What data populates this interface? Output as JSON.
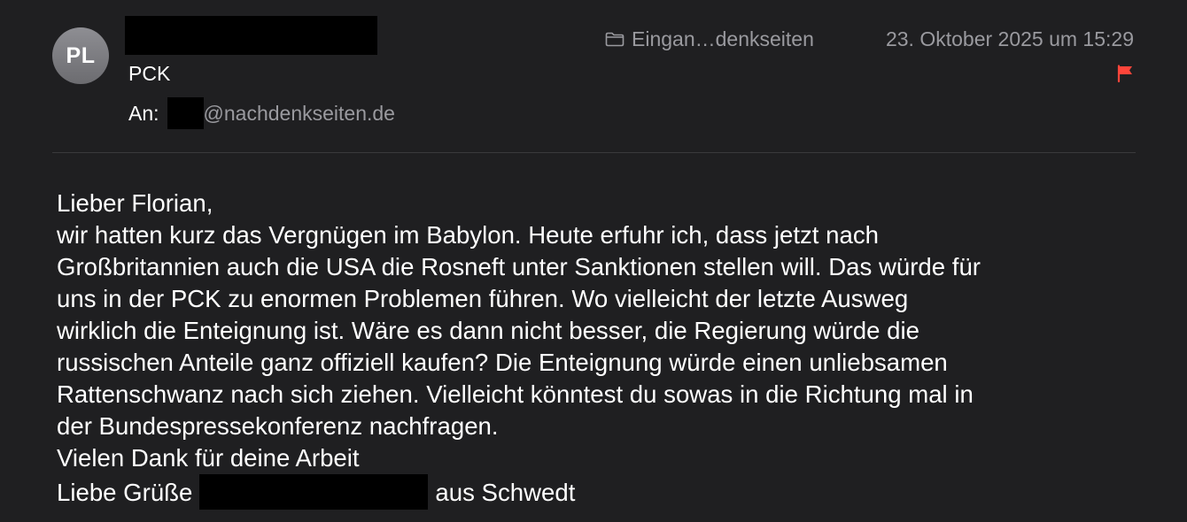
{
  "header": {
    "avatar_initials": "PL",
    "subject": "PCK",
    "to_label": "An:",
    "to_domain": "@nachdenkseiten.de",
    "mailbox": "Eingan…denkseiten",
    "date": "23. Oktober 2025 um 15:29",
    "icons": {
      "folder": "folder-icon",
      "flag": "flag-icon"
    },
    "colors": {
      "flag": "#ff453a",
      "secondary_text": "#9a9a9f",
      "background": "#1f1f21"
    }
  },
  "body": {
    "lines": [
      "Lieber Florian,",
      "wir hatten kurz das Vergnügen im Babylon. Heute erfuhr ich, dass jetzt nach",
      "Großbritannien auch die USA die Rosneft unter Sanktionen stellen will. Das würde für",
      "uns in der PCK zu enormen Problemen führen. Wo vielleicht der letzte Ausweg",
      "wirklich die Enteignung ist. Wäre es dann nicht besser, die Regierung würde die",
      "russischen Anteile ganz offiziell kaufen? Die Enteignung würde einen unliebsamen",
      "Rattenschwanz nach sich ziehen. Vielleicht könntest du sowas in die Richtung mal in",
      "der Bundespressekonferenz nachfragen.",
      "Vielen Dank für deine Arbeit"
    ],
    "closing_prefix": "Liebe Grüße",
    "closing_suffix": "aus Schwedt"
  }
}
